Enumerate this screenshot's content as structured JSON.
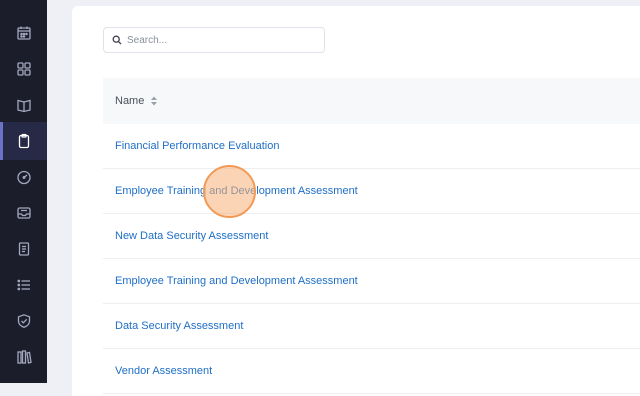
{
  "sidebar": {
    "items": [
      {
        "icon": "grid-icon"
      },
      {
        "icon": "calendar-icon"
      },
      {
        "icon": "dashboard-icon"
      },
      {
        "icon": "book-icon"
      },
      {
        "icon": "clipboard-icon",
        "active": true
      },
      {
        "icon": "speedometer-icon"
      },
      {
        "icon": "inbox-icon"
      },
      {
        "icon": "document-icon"
      },
      {
        "icon": "list-icon"
      },
      {
        "icon": "shield-check-icon"
      },
      {
        "icon": "library-icon"
      }
    ]
  },
  "search": {
    "placeholder": "Search..."
  },
  "table": {
    "header": {
      "name": "Name"
    },
    "rows": [
      "Financial Performance Evaluation",
      "Employee Training and Development Assessment",
      "New Data Security Assessment",
      "Employee Training and Development Assessment",
      "Data Security Assessment",
      "Vendor Assessment"
    ]
  },
  "colors": {
    "sidebar_bg": "#1c1d2b",
    "sidebar_active": "#272a46",
    "link": "#1f6fc5",
    "cursor_highlight": "#f29a55"
  }
}
